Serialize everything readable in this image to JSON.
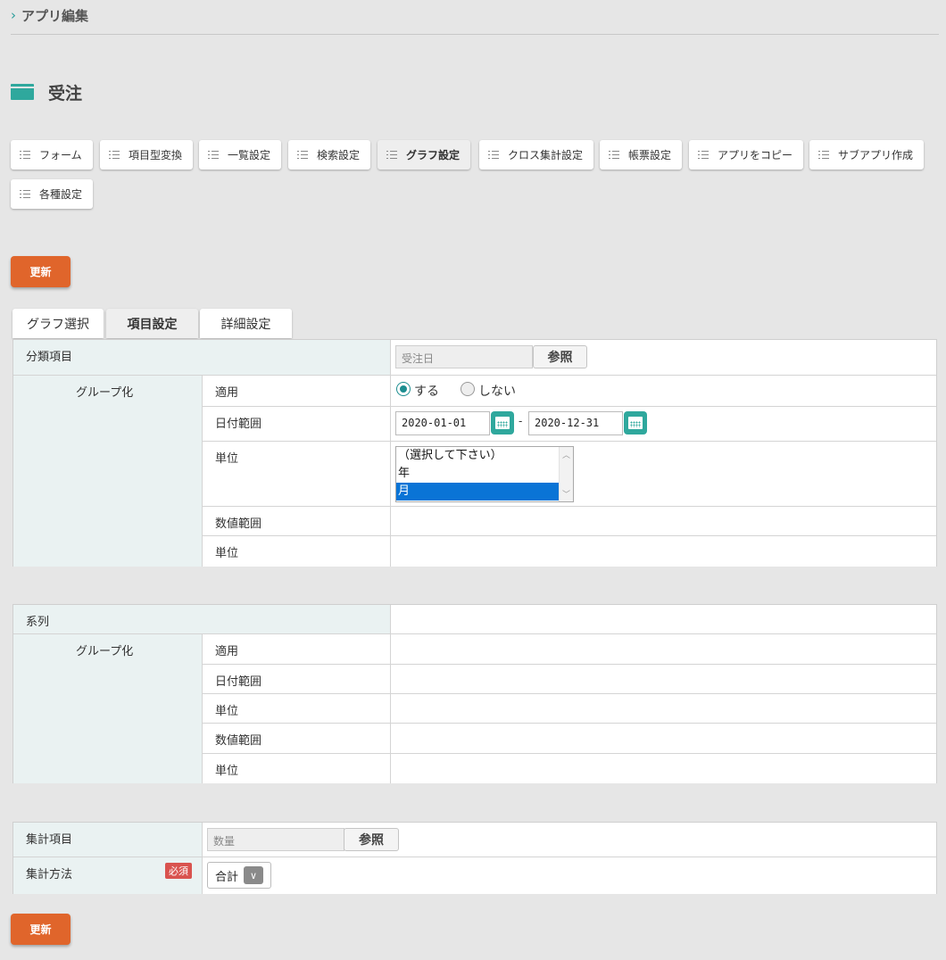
{
  "breadcrumb": {
    "label": "アプリ編集"
  },
  "page": {
    "title": "受注"
  },
  "toolbar": {
    "items": [
      {
        "label": "フォーム"
      },
      {
        "label": "項目型変換"
      },
      {
        "label": "一覧設定"
      },
      {
        "label": "検索設定"
      },
      {
        "label": "グラフ設定",
        "active": true
      },
      {
        "label": "クロス集計設定"
      },
      {
        "label": "帳票設定"
      },
      {
        "label": "アプリをコピー"
      },
      {
        "label": "サブアプリ作成"
      },
      {
        "label": "各種設定"
      }
    ]
  },
  "update_label": "更新",
  "subtabs": [
    {
      "label": "グラフ選択"
    },
    {
      "label": "項目設定",
      "active": true
    },
    {
      "label": "詳細設定"
    }
  ],
  "classification": {
    "label": "分類項目",
    "field_value": "受注日",
    "ref_label": "参照",
    "group_label": "グループ化",
    "apply_label": "適用",
    "apply_yes": "する",
    "apply_no": "しない",
    "apply_selected": "yes",
    "date_range_label": "日付範囲",
    "date_from": "2020-01-01",
    "date_sep": "-",
    "date_to": "2020-12-31",
    "unit_label": "単位",
    "unit_options": [
      "（選択して下さい）",
      "年",
      "月"
    ],
    "unit_selected": "月",
    "num_range_label": "数値範囲",
    "unit2_label": "単位"
  },
  "series": {
    "label": "系列",
    "group_label": "グループ化",
    "apply_label": "適用",
    "date_range_label": "日付範囲",
    "unit_label": "単位",
    "num_range_label": "数値範囲",
    "unit2_label": "単位"
  },
  "aggregate": {
    "label": "集計項目",
    "field_value": "数量",
    "ref_label": "参照",
    "method_label": "集計方法",
    "required_badge": "必須",
    "method_value": "合計"
  },
  "colors": {
    "accent": "#2fa89d",
    "primary_button": "#e0652b",
    "label_bg": "#eaf2f2",
    "required": "#d9534f",
    "selection": "#0a74d6"
  }
}
